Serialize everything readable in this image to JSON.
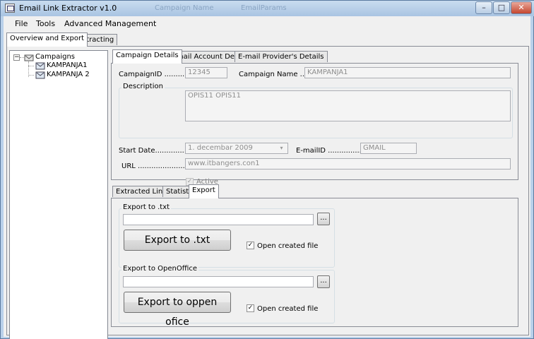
{
  "window": {
    "title": "Email Link Extractor v1.0",
    "ghost_titles": [
      "Campaign Name",
      "EmailParams"
    ],
    "controls": {
      "minimize": "–",
      "maximize": "□",
      "close": "✕"
    }
  },
  "menu": [
    "File",
    "Tools",
    "Advanced Management"
  ],
  "main_tabs": [
    "Overview and Export",
    "Extracting"
  ],
  "tree": {
    "root": "Campaigns",
    "children": [
      "KAMPANJA1",
      "KAMPANJA 2"
    ],
    "expander": "−"
  },
  "detail_tabs": [
    "Campaign Details",
    "E-mail Account Details",
    "E-mail Provider's Details"
  ],
  "campaign": {
    "id_label": "CampaignID .............",
    "id_value": "12345",
    "name_label": "Campaign Name .....",
    "name_value": "KAMPANJA1",
    "description_label": "Description",
    "description_value": "OPIS11 OPIS11",
    "start_date_label": "Start Date...............",
    "start_date_value": "1. decembar 2009",
    "emailid_label": "E-mailID ..................",
    "emailid_value": "GMAIL",
    "url_label": "URL .......................",
    "url_value": "www.itbangers.con1",
    "active_label": "Active",
    "active_checked": "✓"
  },
  "bottom_tabs": [
    "Extracted Links",
    "Statistic",
    "Export"
  ],
  "export": {
    "txt_group": "Export to .txt",
    "txt_path": "",
    "browse_label": "...",
    "txt_button": "Export to .txt",
    "open_created_file": "Open created file",
    "checked_mark": "✓",
    "oo_group": "Export to OpenOffice",
    "oo_path": "",
    "oo_button": "Export to oppen ofice"
  }
}
